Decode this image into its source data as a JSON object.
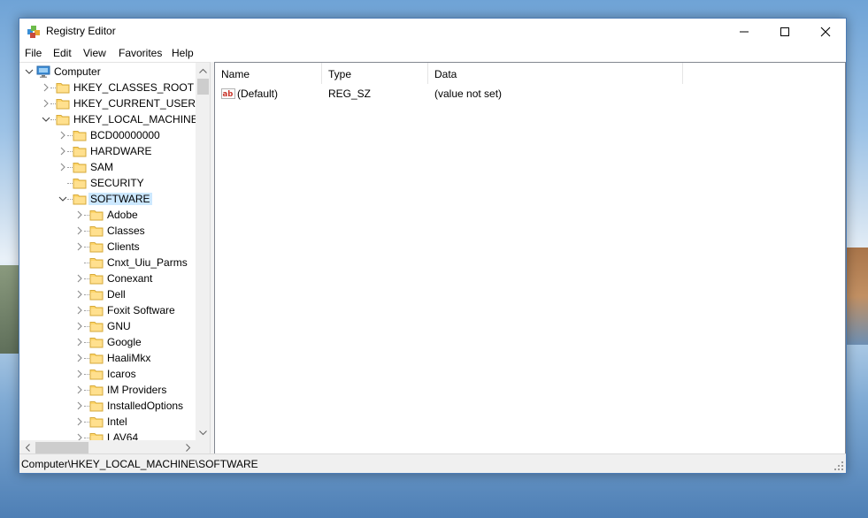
{
  "window": {
    "title": "Registry Editor"
  },
  "menu": [
    "File",
    "Edit",
    "View",
    "Favorites",
    "Help"
  ],
  "tree": {
    "root": "Computer",
    "hives": [
      "HKEY_CLASSES_ROOT",
      "HKEY_CURRENT_USER",
      "HKEY_LOCAL_MACHINE"
    ],
    "hklm_children": [
      "BCD00000000",
      "HARDWARE",
      "SAM",
      "SECURITY",
      "SOFTWARE"
    ],
    "software_children": [
      "Adobe",
      "Classes",
      "Clients",
      "Cnxt_Uiu_Parms",
      "Conexant",
      "Dell",
      "Foxit Software",
      "GNU",
      "Google",
      "HaaliMkx",
      "Icaros",
      "IM Providers",
      "InstalledOptions",
      "Intel",
      "LAV64"
    ],
    "selected": "SOFTWARE"
  },
  "columns": {
    "name": "Name",
    "type": "Type",
    "data": "Data"
  },
  "values": [
    {
      "name": "(Default)",
      "type": "REG_SZ",
      "data": "(value not set)"
    }
  ],
  "status": {
    "path": "Computer\\HKEY_LOCAL_MACHINE\\SOFTWARE"
  },
  "colors": {
    "folder": "#ffd66b",
    "selection": "#cce8ff",
    "window_border": "#4b7bb4"
  }
}
